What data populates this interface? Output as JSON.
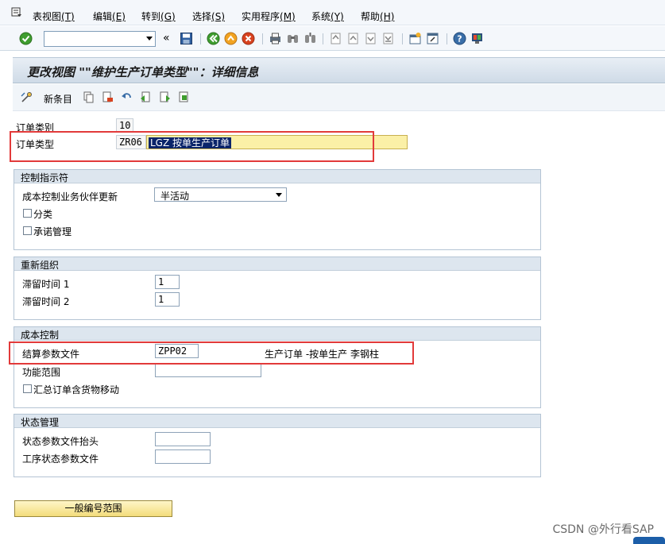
{
  "menu": {
    "items": [
      {
        "label": "表视图",
        "key": "(T)"
      },
      {
        "label": "编辑",
        "key": "(E)"
      },
      {
        "label": "转到",
        "key": "(G)"
      },
      {
        "label": "选择",
        "key": "(S)"
      },
      {
        "label": "实用程序",
        "key": "(M)"
      },
      {
        "label": "系统",
        "key": "(Y)"
      },
      {
        "label": "帮助",
        "key": "(H)"
      }
    ]
  },
  "toolbar": {
    "command_value": "",
    "back_chevron": "«"
  },
  "page": {
    "title": "更改视图 \"\"维护生产订单类型\"\"：详细信息",
    "new_entries_label": "新条目"
  },
  "header_fields": {
    "order_category_label": "订单类别",
    "order_category_value": "10",
    "order_type_label": "订单类型",
    "order_type_code": "ZR06",
    "order_type_desc": "LGZ 按单生产订单"
  },
  "control_group": {
    "title": "控制指示符",
    "co_partner_update_label": "成本控制业务伙伴更新",
    "co_partner_update_value": "半活动",
    "classification_label": "分类",
    "commitment_mgmt_label": "承诺管理"
  },
  "reorg_group": {
    "title": "重新组织",
    "residence_time1_label": "滞留时间 1",
    "residence_time1_value": "1",
    "residence_time2_label": "滞留时间 2",
    "residence_time2_value": "1"
  },
  "cost_group": {
    "title": "成本控制",
    "settlement_profile_label": "结算参数文件",
    "settlement_profile_value": "ZPP02",
    "settlement_profile_desc": "生产订单 -按单生产 李钢柱",
    "functional_area_label": "功能范围",
    "functional_area_value": "",
    "collective_order_label": "汇总订单含货物移动"
  },
  "status_group": {
    "title": "状态管理",
    "status_profile_header_label": "状态参数文件抬头",
    "status_profile_header_value": "",
    "operation_status_profile_label": "工序状态参数文件",
    "operation_status_profile_value": ""
  },
  "buttons": {
    "number_range_label": "一般编号范围"
  },
  "watermark": "CSDN @外行看SAP",
  "colors": {
    "highlight_red": "#e23a3a",
    "field_yellow": "#fbf0a7",
    "selection_blue": "#0a246a",
    "group_header": "#dde6ef"
  }
}
